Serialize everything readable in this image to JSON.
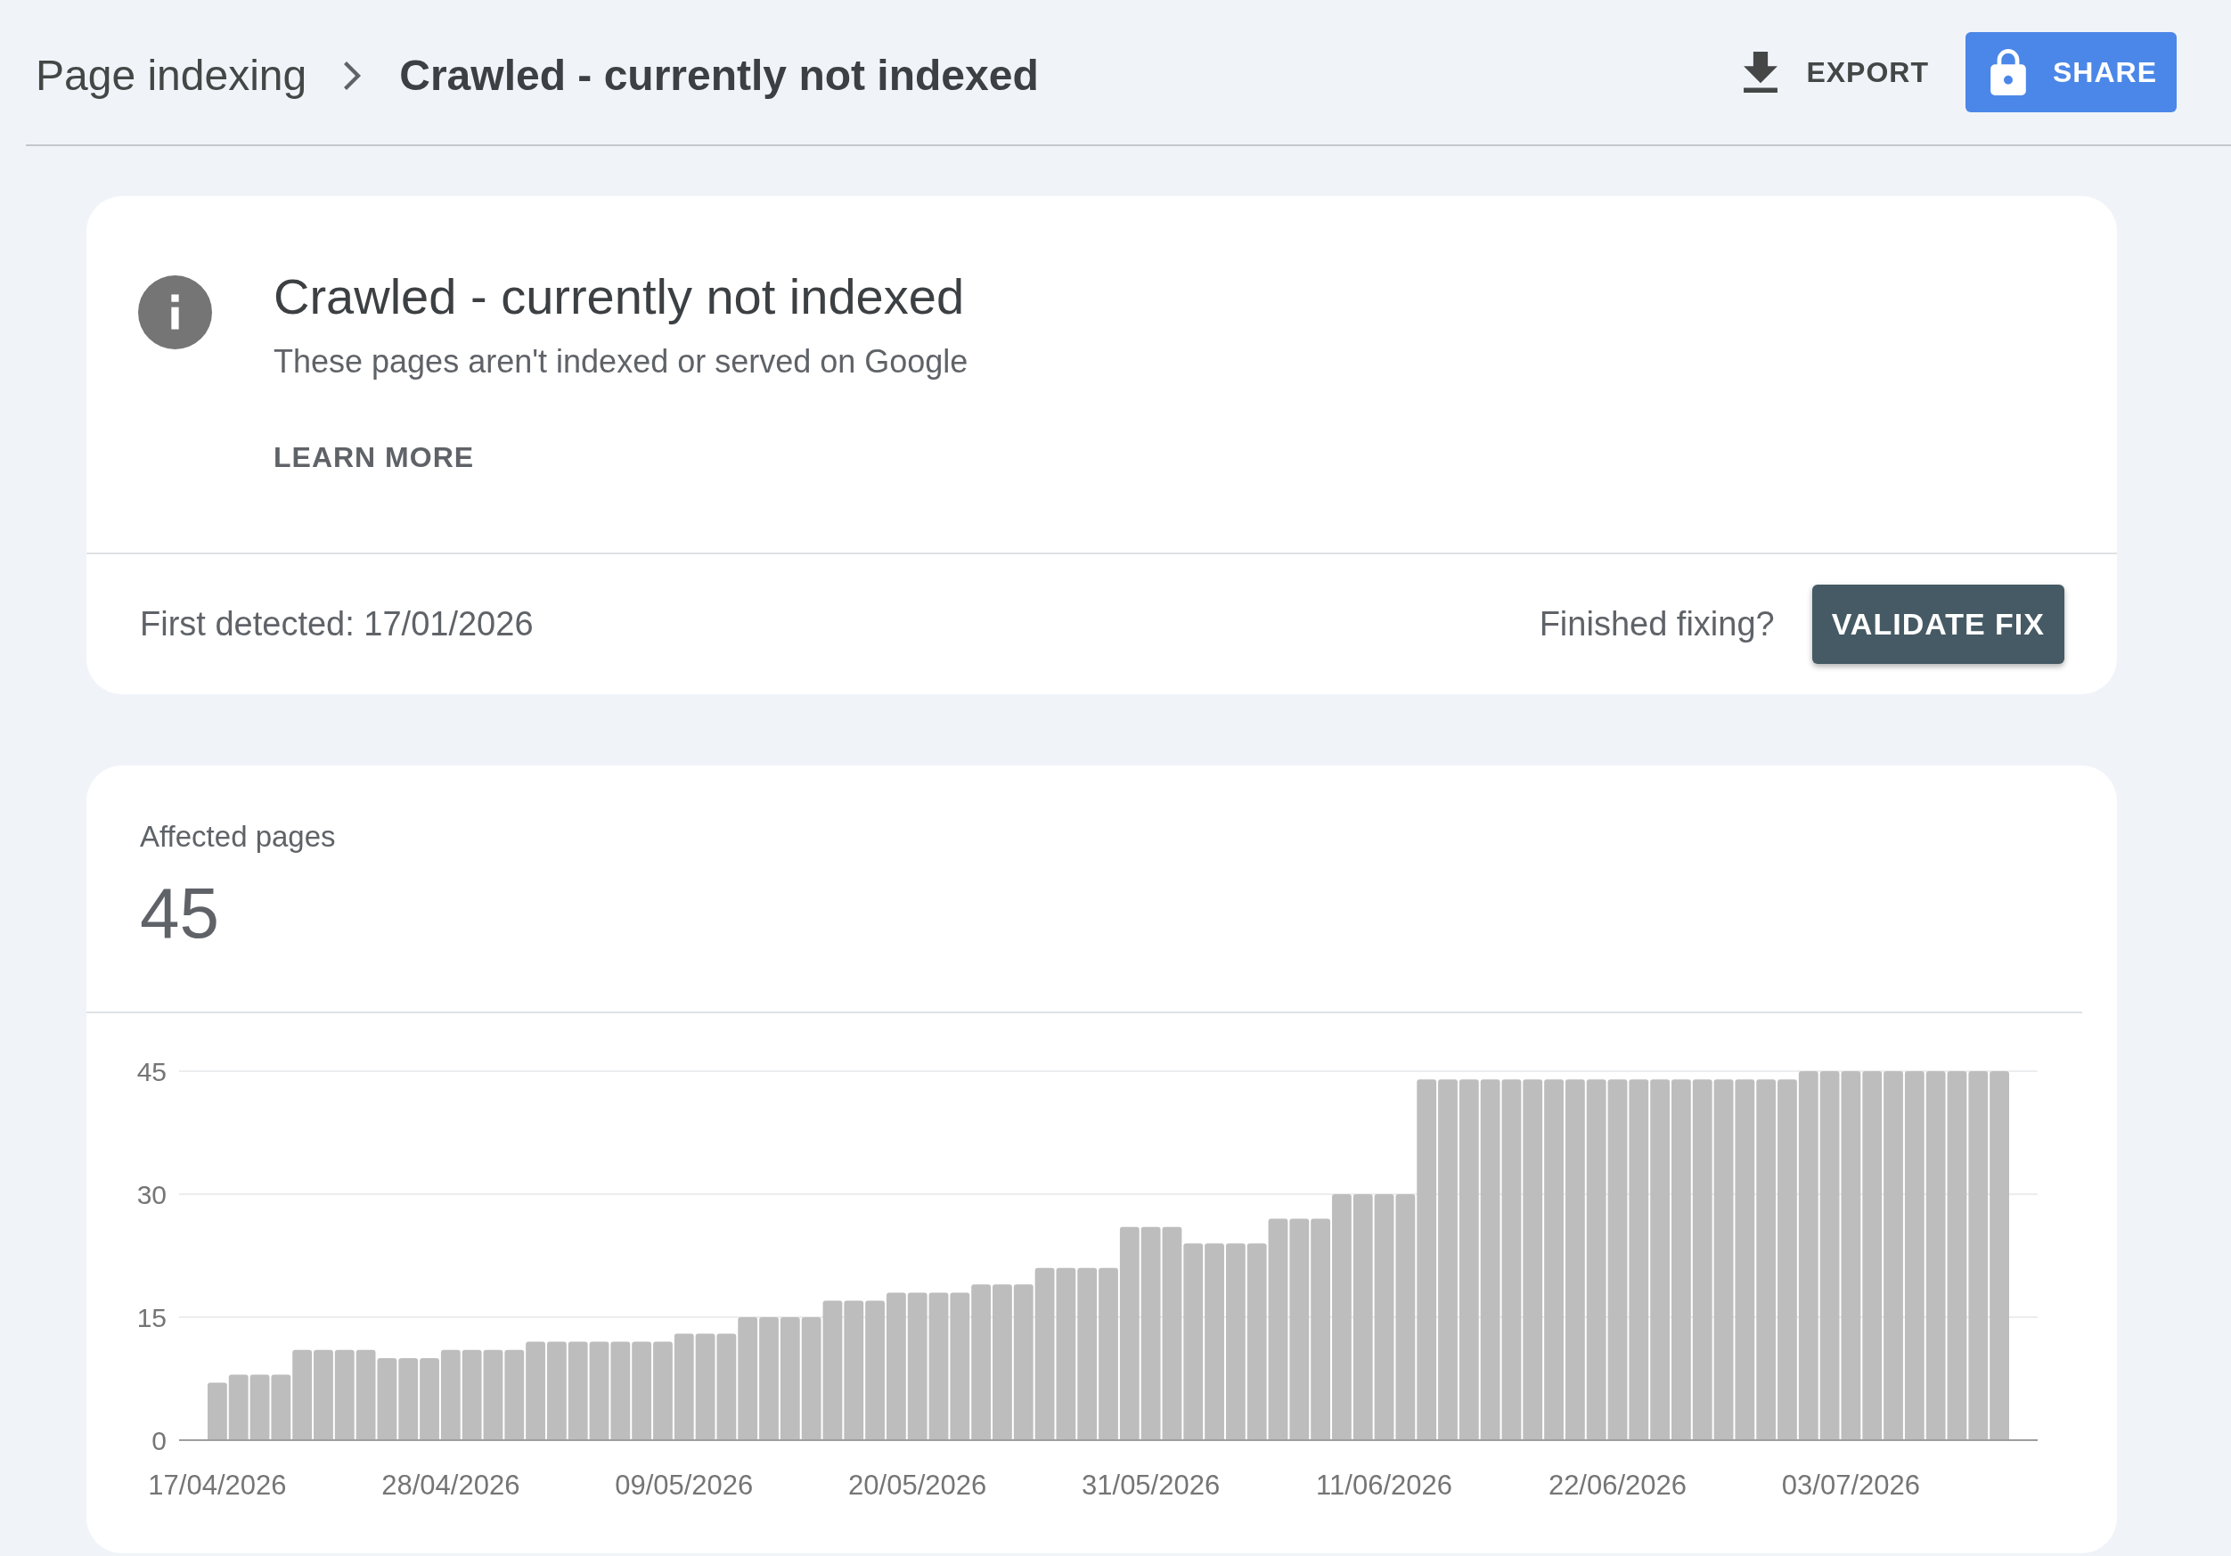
{
  "header": {
    "breadcrumb": [
      {
        "label": "Page indexing",
        "current": false
      },
      {
        "label": "Crawled - currently not indexed",
        "current": true
      }
    ],
    "actions": [
      {
        "kind": "text",
        "label": "EXPORT"
      },
      {
        "kind": "filled",
        "label": "SHARE"
      }
    ]
  },
  "issue_card": {
    "title": "Crawled - currently not indexed",
    "description": "These pages aren't indexed or served on Google",
    "learn_more": "LEARN MORE",
    "first_detected": "First detected: 17/01/2026",
    "prompt": "Finished fixing?",
    "validate_button": "VALIDATE FIX"
  },
  "affected_card": {
    "label": "Affected pages",
    "count": "45",
    "chart_data": {
      "type": "bar",
      "categories": [
        "17/04/2026",
        null,
        null,
        null,
        null,
        null,
        null,
        null,
        null,
        null,
        null,
        "28/04/2026",
        null,
        null,
        null,
        null,
        null,
        null,
        null,
        null,
        null,
        null,
        "09/05/2026",
        null,
        null,
        null,
        null,
        null,
        null,
        null,
        null,
        null,
        null,
        "20/05/2026",
        null,
        null,
        null,
        null,
        null,
        null,
        null,
        null,
        null,
        null,
        "31/05/2026",
        null,
        null,
        null,
        null,
        null,
        null,
        null,
        null,
        null,
        null,
        "11/06/2026",
        null,
        null,
        null,
        null,
        null,
        null,
        null,
        null,
        null,
        null,
        "22/06/2026",
        null,
        null,
        null,
        null,
        null,
        null,
        null,
        null,
        null,
        null,
        "03/07/2026",
        null,
        null,
        null,
        null,
        null,
        null,
        null
      ],
      "values": [
        7,
        8,
        8,
        8,
        11,
        11,
        11,
        11,
        10,
        10,
        10,
        11,
        11,
        11,
        11,
        12,
        12,
        12,
        12,
        12,
        12,
        12,
        13,
        13,
        13,
        15,
        15,
        15,
        15,
        17,
        17,
        17,
        18,
        18,
        18,
        18,
        19,
        19,
        19,
        21,
        21,
        21,
        21,
        26,
        26,
        26,
        24,
        24,
        24,
        24,
        27,
        27,
        27,
        30,
        30,
        30,
        30,
        44,
        44,
        44,
        44,
        44,
        44,
        44,
        44,
        44,
        44,
        44,
        44,
        44,
        44,
        44,
        44,
        44,
        44,
        45,
        45,
        45,
        45,
        45,
        45,
        45,
        45,
        45,
        45
      ],
      "ylim": [
        0,
        45
      ],
      "yticks": [
        0,
        15,
        30,
        45
      ]
    }
  }
}
